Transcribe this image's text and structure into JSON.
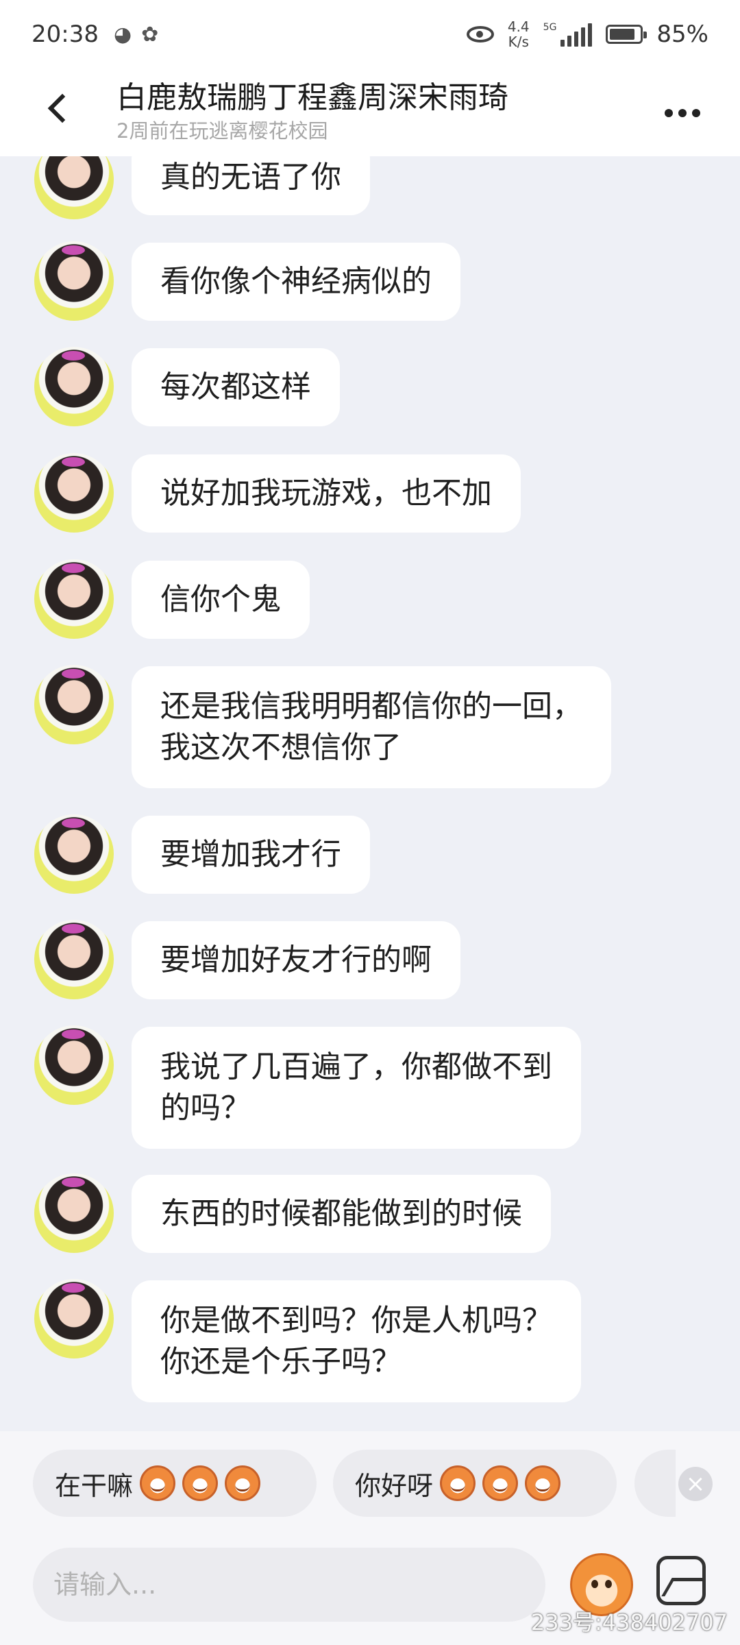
{
  "status_bar": {
    "time": "20:38",
    "wechat_icon": "wechat-icon",
    "baidu_icon": "paw-icon",
    "net_speed_value": "4.4",
    "net_speed_unit": "K/s",
    "network_type": "5G",
    "battery_level": 0.85,
    "battery_percent": "85%"
  },
  "header": {
    "title": "白鹿敖瑞鹏丁程鑫周深宋雨琦",
    "subtitle": "2周前在玩逃离樱花校园"
  },
  "messages": [
    {
      "text": "真的无语了你"
    },
    {
      "text": "看你像个神经病似的"
    },
    {
      "text": "每次都这样"
    },
    {
      "text": "说好加我玩游戏，也不加"
    },
    {
      "text": "信你个鬼"
    },
    {
      "text": "还是我信我明明都信你的一回，\n我这次不想信你了"
    },
    {
      "text": "要增加我才行"
    },
    {
      "text": "要增加好友才行的啊"
    },
    {
      "text": "我说了几百遍了，你都做不到\n的吗？"
    },
    {
      "text": "东西的时候都能做到的时候"
    },
    {
      "text": "你是做不到吗？你是人机吗？\n你还是个乐子吗？"
    }
  ],
  "quick_replies": [
    {
      "label": "在干嘛",
      "emoji": "grinning-monkey-emoji"
    },
    {
      "label": "你好呀",
      "emoji": "monkey-face-emoji"
    }
  ],
  "input": {
    "placeholder": "请输入..."
  },
  "watermark": "233号:438402707",
  "colors": {
    "background": "#eef0f6",
    "bubble": "#ffffff",
    "chip": "#ebebef"
  }
}
